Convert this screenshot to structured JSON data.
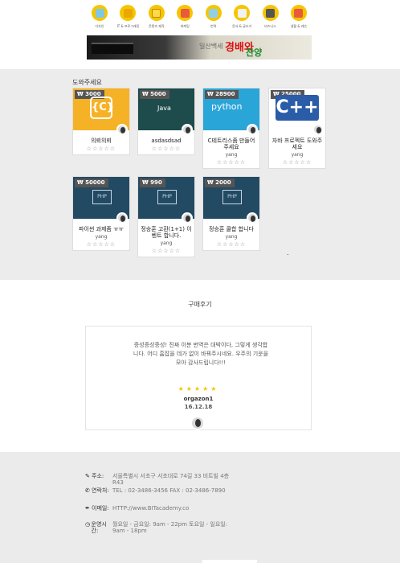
{
  "nav": {
    "items": [
      {
        "label": "디자인",
        "icon": "design-icon"
      },
      {
        "label": "IT & 프로그래밍",
        "icon": "it-programming-icon"
      },
      {
        "label": "콘텐츠 제작",
        "icon": "content-icon"
      },
      {
        "label": "마케팅",
        "icon": "marketing-icon"
      },
      {
        "label": "번역",
        "icon": "translation-icon"
      },
      {
        "label": "문서 & 글쓰기",
        "icon": "document-icon"
      },
      {
        "label": "비즈니스",
        "icon": "business-icon"
      },
      {
        "label": "생활 & 레슨",
        "icon": "lesson-icon"
      }
    ]
  },
  "banner": {
    "subtitle": "일산백세",
    "title_1": "경배와",
    "title_2": "찬양"
  },
  "products": {
    "title": "도와주세요",
    "items": [
      {
        "price": "₩ 3000",
        "title": "의뢰의뢰",
        "author": "",
        "stars": "☆☆☆☆☆",
        "thumb": "c",
        "logo": "{C}"
      },
      {
        "price": "₩ 5000",
        "title": "asdasdsad",
        "author": "",
        "stars": "☆☆☆☆☆",
        "thumb": "java",
        "logo": "Java"
      },
      {
        "price": "₩ 28900",
        "title": "C테트리스좀 만들어 주세요",
        "author": "yang",
        "stars": "☆☆☆☆☆",
        "thumb": "python",
        "logo": "python"
      },
      {
        "price": "₩ 25000",
        "title": "자바 프로젝트 도와주세요",
        "author": "yang",
        "stars": "☆☆☆☆☆",
        "thumb": "cpp",
        "logo": "C++"
      },
      {
        "price": "₩ 50000",
        "title": "파이썬 과제좀 ㅠㅠ",
        "author": "yang",
        "stars": "☆☆☆☆☆",
        "thumb": "php",
        "logo": "PHP"
      },
      {
        "price": "₩ 990",
        "title": "정승훈 고환(1+1) 이벤트 합니다.",
        "author": "yang",
        "stars": "☆☆☆☆☆",
        "thumb": "php",
        "logo": "PHP"
      },
      {
        "price": "₩ 2000",
        "title": "정승훈 쿨합 합니다",
        "author": "yang",
        "stars": "☆☆☆☆☆",
        "thumb": "php",
        "logo": "PHP"
      }
    ],
    "dot": "."
  },
  "review": {
    "title": "구매후기",
    "text": "증성증성증성! 진짜 이분 번역은 대박이다, 그렇게 생각합니다. 어디 흠잡을 데가 없이 바꿔주시네요. 우주의 기운을 모아 감사드립니다!!!",
    "stars": "★★★★★",
    "rating": 5,
    "name": "orgazon1",
    "date": "16.12.18"
  },
  "footer": {
    "address_label": "주소:",
    "address": "서울특별시 서초구 서초대로 74길 33 비트빌 4층 R43",
    "phone_label": "연락처:",
    "phone": "TEL : 02-3486-3456 FAX : 02-3486-7890",
    "email_label": "이메일:",
    "email": "HTTP://www.BITacademy.co",
    "hours_label": "운영시간:",
    "hours": "월요일 - 금요일: 9am - 22pm 토요일 - 일요일: 9am - 18pm"
  }
}
